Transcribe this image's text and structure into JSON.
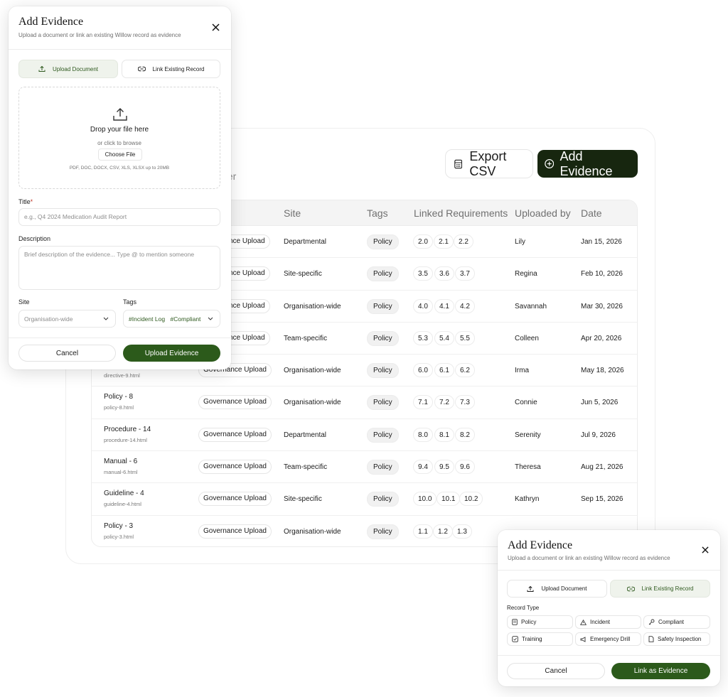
{
  "page": {
    "subtitle_fragment": "der",
    "export_label": "Export CSV",
    "add_label": "Add Evidence"
  },
  "table": {
    "headers": [
      "Site",
      "Tags",
      "Linked Requirements",
      "Uploaded by",
      "Date"
    ],
    "rows": [
      {
        "name": "",
        "file": "",
        "type": "nce Upload",
        "site": "Departmental",
        "tag": "Policy",
        "reqs": [
          "2.0",
          "2.1",
          "2.2"
        ],
        "by": "Lily",
        "date": "Jan 15, 2026"
      },
      {
        "name": "",
        "file": "",
        "type": "nce Upload",
        "site": "Site-specific",
        "tag": "Policy",
        "reqs": [
          "3.5",
          "3.6",
          "3.7"
        ],
        "by": "Regina",
        "date": "Feb 10, 2026"
      },
      {
        "name": "",
        "file": "",
        "type": "nce Upload",
        "site": "Organisation-wide",
        "tag": "Policy",
        "reqs": [
          "4.0",
          "4.1",
          "4.2"
        ],
        "by": "Savannah",
        "date": "Mar 30, 2026"
      },
      {
        "name": "",
        "file": "",
        "type": "nce Upload",
        "site": "Team-specific",
        "tag": "Policy",
        "reqs": [
          "5.3",
          "5.4",
          "5.5"
        ],
        "by": "Colleen",
        "date": "Apr 20, 2026"
      },
      {
        "name": "",
        "file": "directive-9.html",
        "type": "Governance Upload",
        "site": "Organisation-wide",
        "tag": "Policy",
        "reqs": [
          "6.0",
          "6.1",
          "6.2"
        ],
        "by": "Irma",
        "date": "May 18, 2026"
      },
      {
        "name": "Policy - 8",
        "file": "policy-8.html",
        "type": "Governance Upload",
        "site": "Organisation-wide",
        "tag": "Policy",
        "reqs": [
          "7.1",
          "7.2",
          "7.3"
        ],
        "by": "Connie",
        "date": "Jun 5, 2026"
      },
      {
        "name": "Procedure - 14",
        "file": "procedure-14.html",
        "type": "Governance Upload",
        "site": "Departmental",
        "tag": "Policy",
        "reqs": [
          "8.0",
          "8.1",
          "8.2"
        ],
        "by": "Serenity",
        "date": "Jul 9, 2026"
      },
      {
        "name": "Manual - 6",
        "file": "manual-6.html",
        "type": "Governance Upload",
        "site": "Team-specific",
        "tag": "Policy",
        "reqs": [
          "9.4",
          "9.5",
          "9.6"
        ],
        "by": "Theresa",
        "date": "Aug 21, 2026"
      },
      {
        "name": "Guideline - 4",
        "file": "guideline-4.html",
        "type": "Governance Upload",
        "site": "Site-specific",
        "tag": "Policy",
        "reqs": [
          "10.0",
          "10.1",
          "10.2"
        ],
        "by": "Kathryn",
        "date": "Sep 15, 2026"
      },
      {
        "name": "Policy - 3",
        "file": "policy-3.html",
        "type": "Governance Upload",
        "site": "Organisation-wide",
        "tag": "Policy",
        "reqs": [
          "1.1",
          "1.2",
          "1.3"
        ],
        "by": "",
        "date": ""
      }
    ]
  },
  "modal1": {
    "title": "Add Evidence",
    "subtitle": "Upload a document or link an existing Willow record as evidence",
    "tab_upload": "Upload Document",
    "tab_link": "Link Existing Record",
    "drop_title": "Drop your file here",
    "drop_or": "or click to browse",
    "choose_file": "Choose File",
    "formats": "PDF, DOC, DOCX, CSV, XLS, XLSX up to 20MB",
    "title_label": "Title",
    "title_required": "*",
    "title_placeholder": "e.g., Q4 2024 Medication Audit Report",
    "desc_label": "Description",
    "desc_placeholder": "Brief description of the evidence... Type @ to mention someone",
    "site_label": "Site",
    "site_value": "Organisation-wide",
    "tags_label": "Tags",
    "tag1": "#Incident Log",
    "tag2": "#Compliant",
    "cancel": "Cancel",
    "submit": "Upload Evidence"
  },
  "modal2": {
    "title": "Add Evidence",
    "subtitle": "Upload a document or link an existing Willow record as evidence",
    "tab_upload": "Upload Document",
    "tab_link": "Link Existing Record",
    "record_type_label": "Record Type",
    "types": [
      "Policy",
      "Incident",
      "Compliant",
      "Training",
      "Emergency Drill",
      "Safety Inspection"
    ],
    "cancel": "Cancel",
    "submit": "Link as Evidence"
  },
  "colors": {
    "primary_dark": "#17260f",
    "primary_green": "#2c5a1b",
    "accent_green_text": "#2f5a1f"
  }
}
